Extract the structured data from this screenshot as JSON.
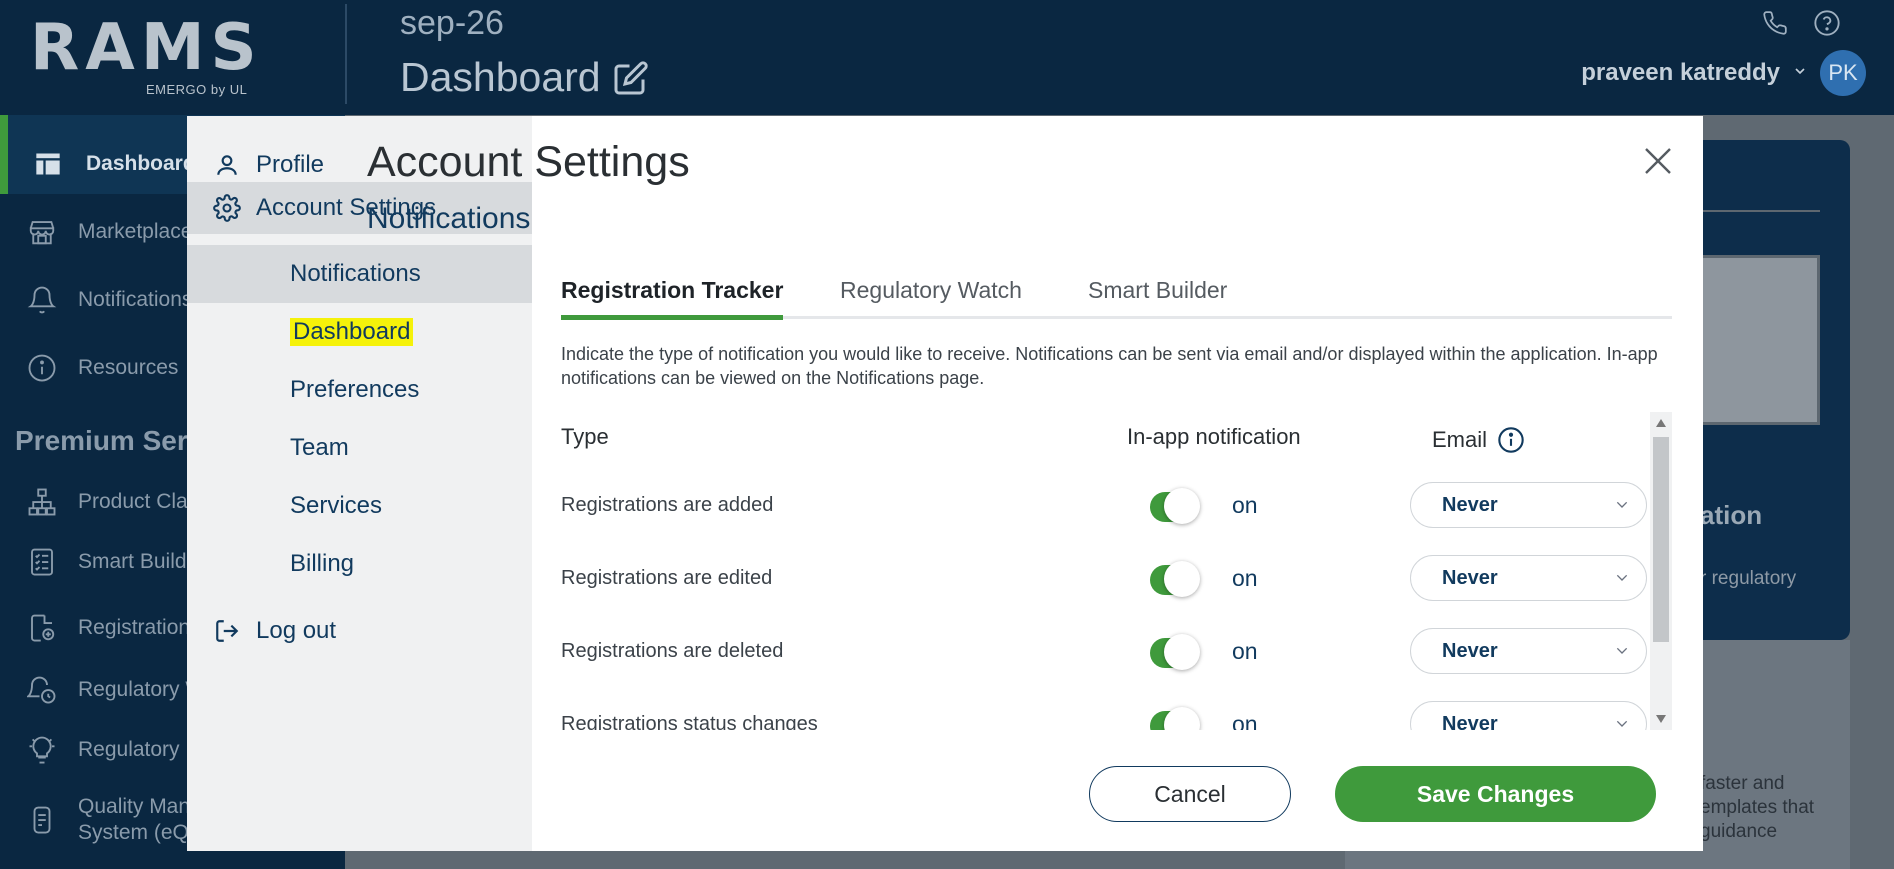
{
  "app": {
    "logo_text": "RAMS",
    "logo_subtext": "EMERGO by UL",
    "project_name": "sep-26",
    "page_title": "Dashboard",
    "user_name": "praveen katreddy",
    "user_initials": "PK"
  },
  "sidebar": {
    "items": [
      {
        "label": "Dashboard",
        "icon": "dashboard-icon",
        "active": true
      },
      {
        "label": "Marketplace",
        "icon": "marketplace-icon"
      },
      {
        "label": "Notifications",
        "icon": "bell-icon"
      },
      {
        "label": "Resources",
        "icon": "info-icon"
      }
    ],
    "section_title": "Premium Ser",
    "premium_items": [
      {
        "label": "Product Cla",
        "icon": "hierarchy-icon"
      },
      {
        "label": "Smart Build",
        "icon": "checklist-icon"
      },
      {
        "label": "Registration",
        "icon": "registration-icon"
      },
      {
        "label": "Regulatory W",
        "icon": "regulatory-watch-icon"
      },
      {
        "label": "Regulatory I",
        "icon": "lightbulb-icon"
      },
      {
        "label_line1": "Quality Man",
        "label_line2": "System (eQ",
        "icon": "quality-icon"
      }
    ]
  },
  "background": {
    "card_title": "ation",
    "card_text": "r regulatory",
    "lower_line1": "faster and",
    "lower_line2": "emplates that",
    "lower_line3": "guidance"
  },
  "modal": {
    "nav": {
      "profile": "Profile",
      "account_settings": "Account Settings",
      "sub_items": [
        "Notifications",
        "Dashboard",
        "Preferences",
        "Team",
        "Services",
        "Billing"
      ],
      "logout": "Log out"
    },
    "title": "Account Settings",
    "section": "Notifications",
    "tabs": [
      "Registration Tracker",
      "Regulatory Watch",
      "Smart Builder"
    ],
    "description": "Indicate the type of notification you would like to receive. Notifications can be sent via email and/or displayed within the application. In-app notifications can be viewed on the Notifications page.",
    "table": {
      "col_type": "Type",
      "col_inapp": "In-app notification",
      "col_email": "Email",
      "rows": [
        {
          "type": "Registrations are added",
          "inapp": "on",
          "email": "Never"
        },
        {
          "type": "Registrations are edited",
          "inapp": "on",
          "email": "Never"
        },
        {
          "type": "Registrations are deleted",
          "inapp": "on",
          "email": "Never"
        },
        {
          "type": "Registrations status changes",
          "inapp": "on",
          "email": "Never"
        }
      ]
    },
    "cancel_label": "Cancel",
    "save_label": "Save Changes"
  },
  "colors": {
    "navy": "#0a2741",
    "accent_green": "#3f9a3c",
    "text_blue": "#113a5e",
    "highlight_yellow": "#f5f20a"
  }
}
